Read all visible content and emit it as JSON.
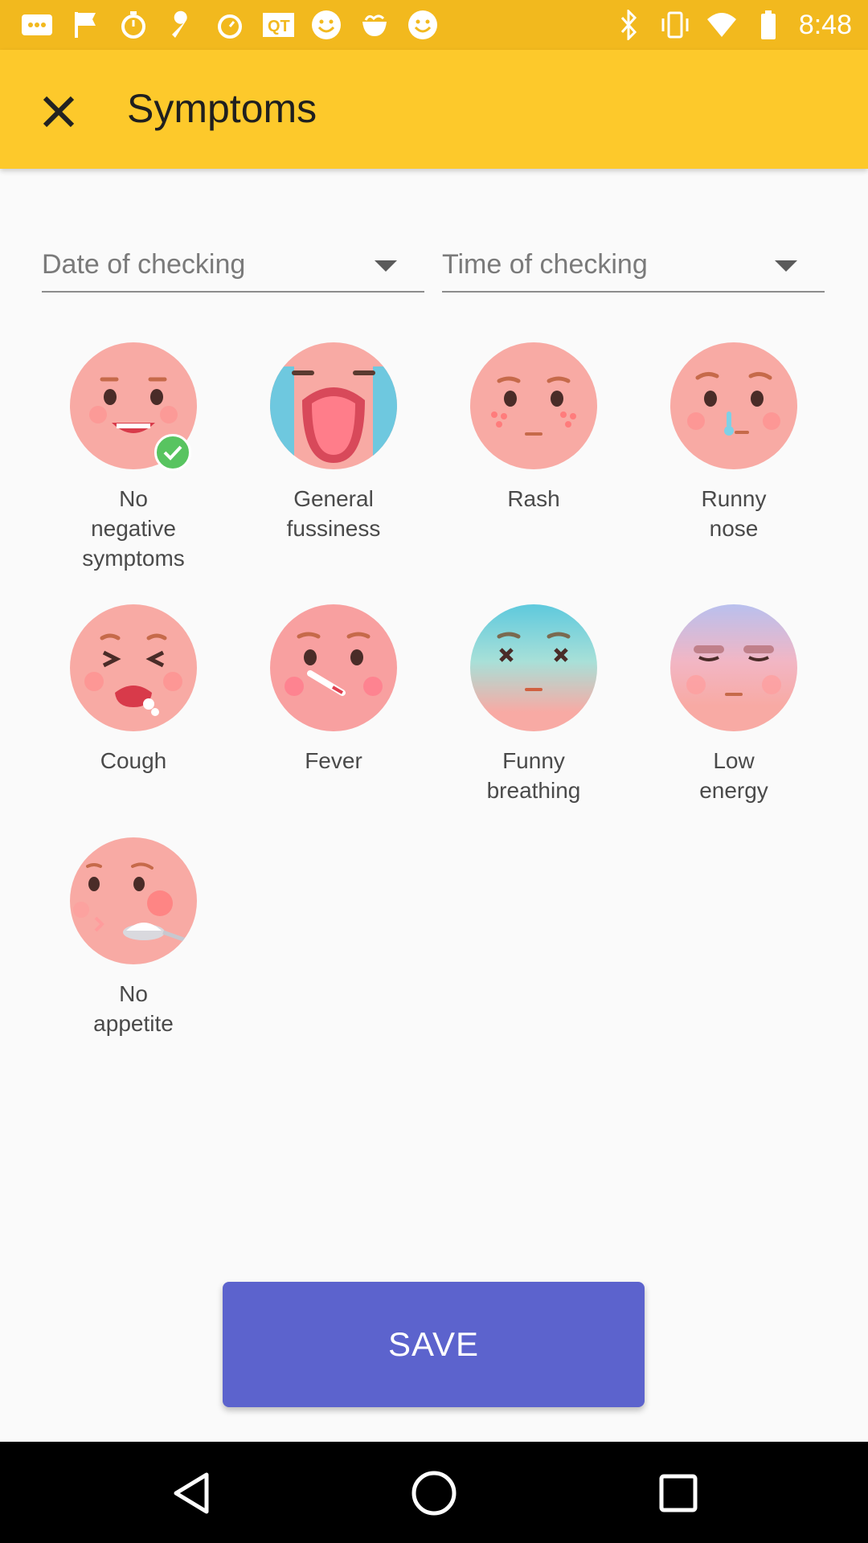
{
  "status_bar": {
    "time": "8:48",
    "icons": [
      "message-dots-icon",
      "flag-icon",
      "timer-icon",
      "wrench-icon",
      "alarm-icon",
      "qt-icon",
      "smiley-icon",
      "pasta-icon",
      "smiley-icon",
      "bluetooth-icon",
      "vibrate-icon",
      "wifi-icon",
      "battery-icon"
    ]
  },
  "app_bar": {
    "title": "Symptoms",
    "close_icon": "close-icon"
  },
  "filters": {
    "date_placeholder": "Date of checking",
    "time_placeholder": "Time of checking"
  },
  "symptoms": [
    {
      "label": "No\nnegative\nsymptoms",
      "selected": true
    },
    {
      "label": "General\nfussiness",
      "selected": false
    },
    {
      "label": "Rash",
      "selected": false
    },
    {
      "label": "Runny\nnose",
      "selected": false
    },
    {
      "label": "Cough",
      "selected": false
    },
    {
      "label": "Fever",
      "selected": false
    },
    {
      "label": "Funny\nbreathing",
      "selected": false
    },
    {
      "label": "Low\nenergy",
      "selected": false
    },
    {
      "label": "No\nappetite",
      "selected": false
    }
  ],
  "save_label": "SAVE",
  "colors": {
    "accent": "#5c63cd",
    "app_bar": "#fdc92b",
    "status_bar": "#f2b91e",
    "face": "#f7a9a3"
  }
}
